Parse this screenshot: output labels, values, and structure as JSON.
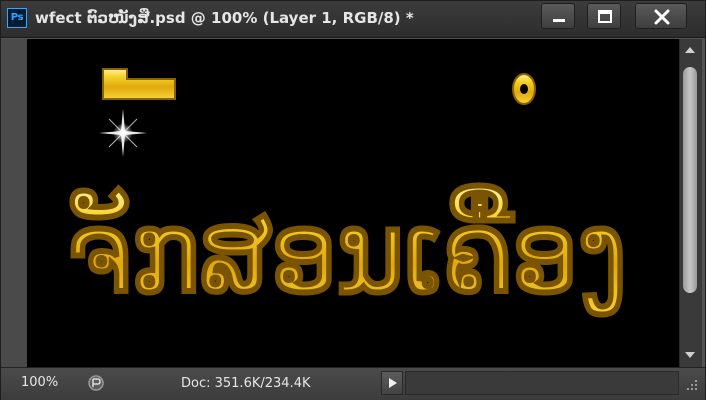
{
  "app": {
    "badge": "Ps",
    "title": "wfect ຕົວໜັງສື.psd @ 100% (Layer 1, RGB/8) *"
  },
  "window_controls": {
    "minimize_icon": "minimize-icon",
    "maximize_icon": "maximize-icon",
    "close_icon": "close-icon"
  },
  "canvas": {
    "artwork_text": "ຈັກສອນເຄື່ອງ",
    "background": "#000000",
    "text_color": "#f2c416"
  },
  "status": {
    "zoom": "100%",
    "doc_info": "Doc: 351.6K/234.4K"
  },
  "colors": {
    "ps_accent": "#31a8ff",
    "gold": "#f2c416",
    "chrome": "#3c3c3c"
  }
}
